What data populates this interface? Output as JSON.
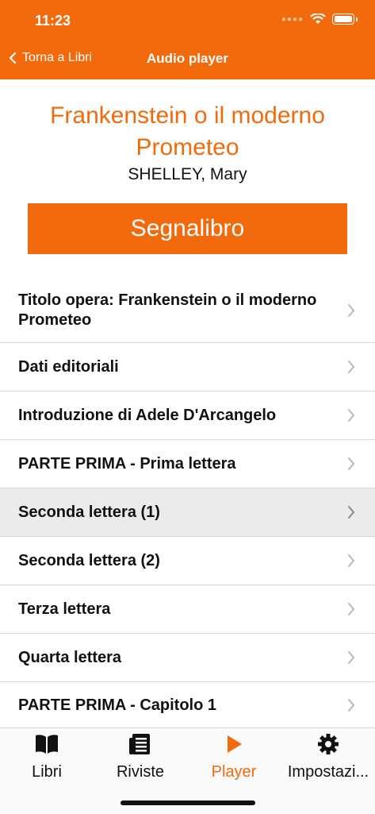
{
  "status": {
    "time": "11:23"
  },
  "nav": {
    "back_label": "Torna a Libri",
    "title": "Audio player"
  },
  "book": {
    "title": "Frankenstein o il moderno Prometeo",
    "author": "SHELLEY, Mary"
  },
  "bookmark_button": "Segnalibro",
  "colors": {
    "accent": "#f26a0c",
    "selected_row": "#ebebeb"
  },
  "chapters": [
    {
      "label": "Titolo opera: Frankenstein o il moderno Prometeo",
      "selected": false
    },
    {
      "label": "Dati editoriali",
      "selected": false
    },
    {
      "label": "Introduzione di Adele D'Arcangelo",
      "selected": false
    },
    {
      "label": "PARTE PRIMA - Prima lettera",
      "selected": false
    },
    {
      "label": "Seconda lettera (1)",
      "selected": true
    },
    {
      "label": "Seconda lettera (2)",
      "selected": false
    },
    {
      "label": "Terza lettera",
      "selected": false
    },
    {
      "label": "Quarta lettera",
      "selected": false
    },
    {
      "label": "PARTE PRIMA - Capitolo 1",
      "selected": false
    }
  ],
  "tabs": [
    {
      "label": "Libri",
      "icon": "book-icon",
      "active": false
    },
    {
      "label": "Riviste",
      "icon": "newspaper-icon",
      "active": false
    },
    {
      "label": "Player",
      "icon": "play-icon",
      "active": true
    },
    {
      "label": "Impostazi...",
      "icon": "gear-icon",
      "active": false
    }
  ]
}
